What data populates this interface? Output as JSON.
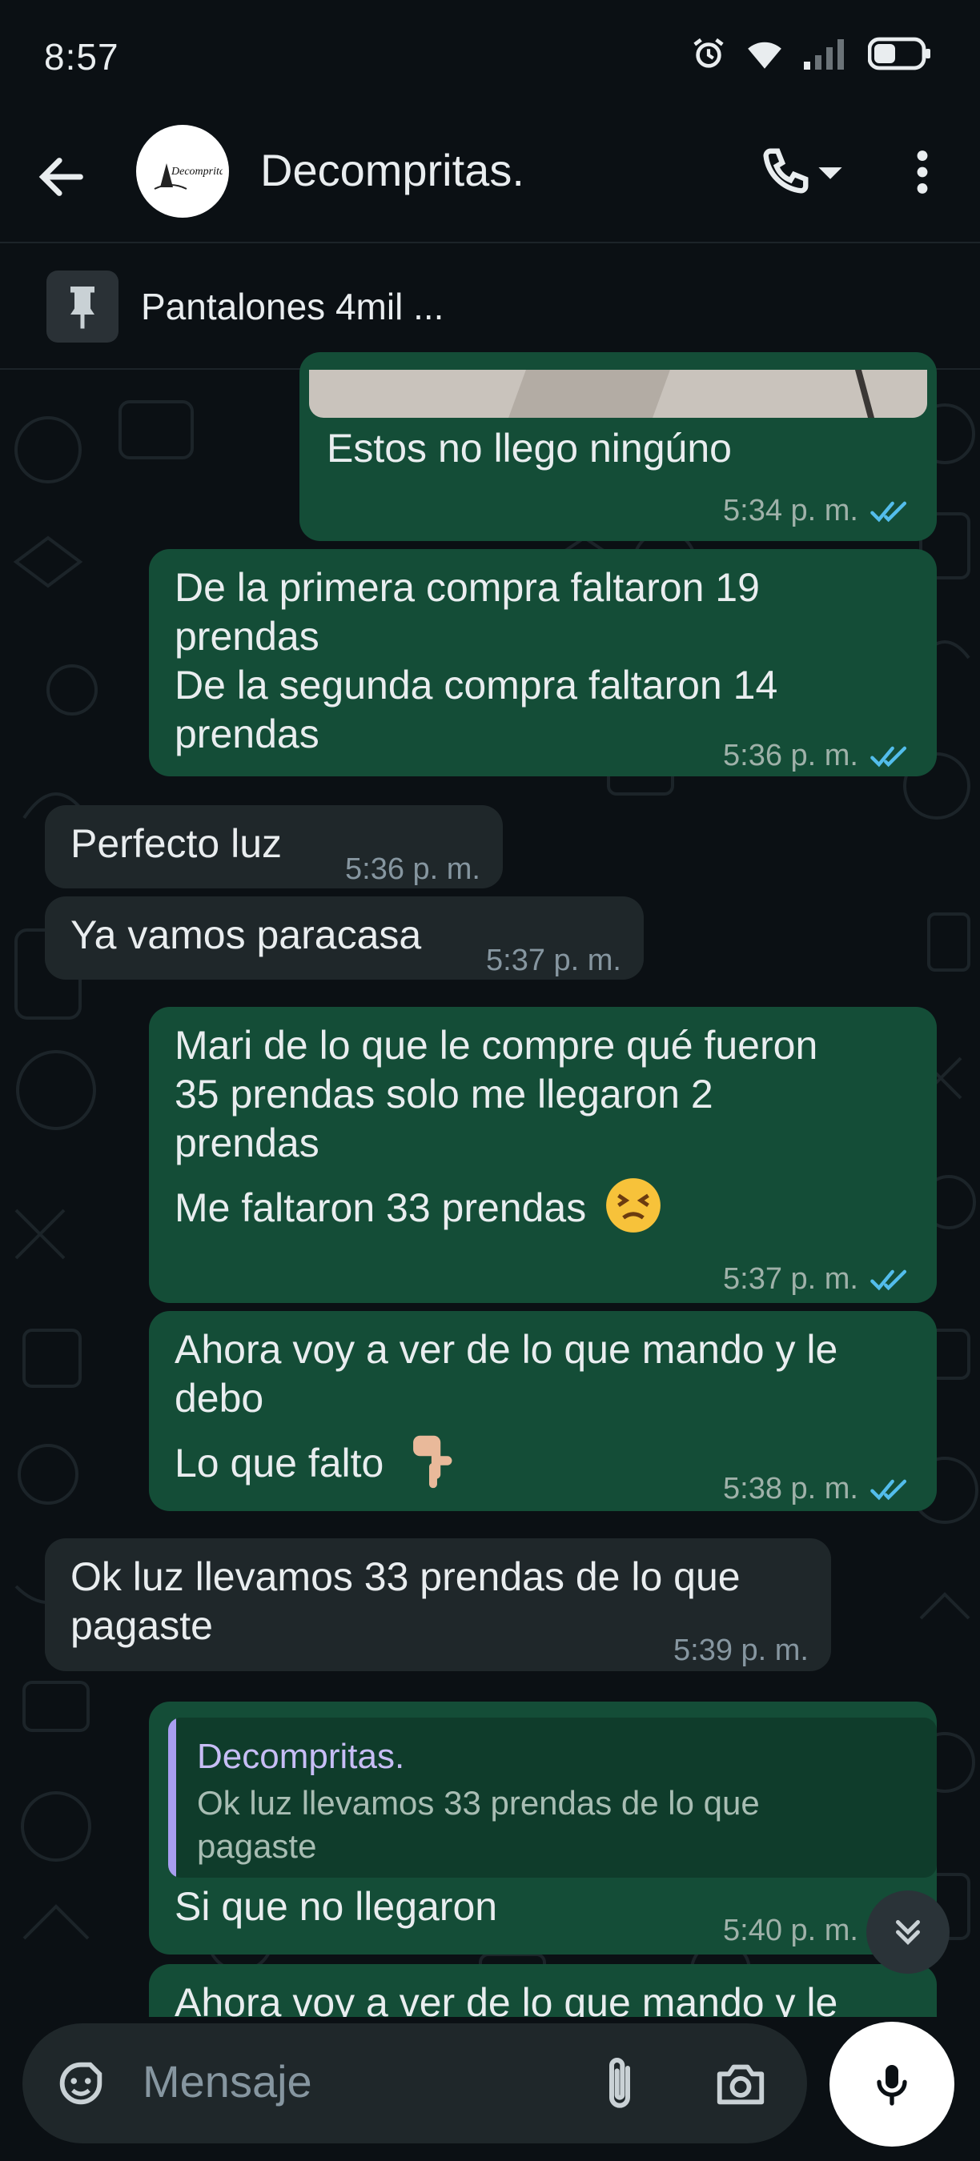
{
  "status_bar": {
    "time": "8:57"
  },
  "header": {
    "contact_name": "Decompritas.",
    "avatar_text": "Decompritas"
  },
  "pinned": {
    "text": "Pantalones 4mil ..."
  },
  "messages": [
    {
      "dir": "out",
      "lines": [
        "Estos no llego ningúno"
      ],
      "time": "5:34 p. m.",
      "read": true
    },
    {
      "dir": "out",
      "lines": [
        "De la primera compra faltaron 19",
        "prendas",
        "De la segunda compra faltaron 14",
        "prendas"
      ],
      "time": "5:36 p. m.",
      "read": true
    },
    {
      "dir": "in",
      "lines": [
        "Perfecto luz"
      ],
      "time": "5:36 p. m."
    },
    {
      "dir": "in",
      "lines": [
        "Ya vamos paracasa"
      ],
      "time": "5:37 p. m."
    },
    {
      "dir": "out",
      "lines": [
        "Mari de lo que le compre qué fueron",
        "35 prendas solo me llegaron 2",
        "prendas",
        "Me faltaron 33 prendas"
      ],
      "emoji": "persevering-face",
      "time": "5:37 p. m.",
      "read": true
    },
    {
      "dir": "out",
      "lines": [
        "Ahora voy a ver de lo que mando y le",
        "debo",
        "Lo que falto"
      ],
      "emoji": "pointing-down-hand",
      "time": "5:38 p. m.",
      "read": true
    },
    {
      "dir": "in",
      "lines": [
        "Ok luz llevamos 33 prendas de lo que",
        "pagaste"
      ],
      "time": "5:39 p. m."
    },
    {
      "dir": "out",
      "reply": {
        "author": "Decompritas.",
        "lines": [
          "Ok luz llevamos 33 prendas de lo que",
          "pagaste"
        ]
      },
      "lines": [
        "Si que no llegaron"
      ],
      "time": "5:40 p. m.",
      "read": true
    },
    {
      "dir": "out",
      "lines": [
        "Ahora voy a ver de lo que mando y le"
      ],
      "partial": true
    }
  ],
  "composer": {
    "placeholder": "Mensaje"
  },
  "colors": {
    "outgoing": "#144d37",
    "incoming": "#1f272a",
    "read_ticks": "#53bdeb",
    "background": "#0b1014"
  },
  "icons": [
    "back-arrow-icon",
    "phone-icon",
    "dropdown-caret-icon",
    "more-vert-icon",
    "pin-icon",
    "double-check-icon",
    "chevron-double-down-icon",
    "sticker-icon",
    "paperclip-icon",
    "camera-icon",
    "mic-icon",
    "alarm-icon",
    "wifi-icon",
    "signal-icon",
    "battery-icon"
  ]
}
